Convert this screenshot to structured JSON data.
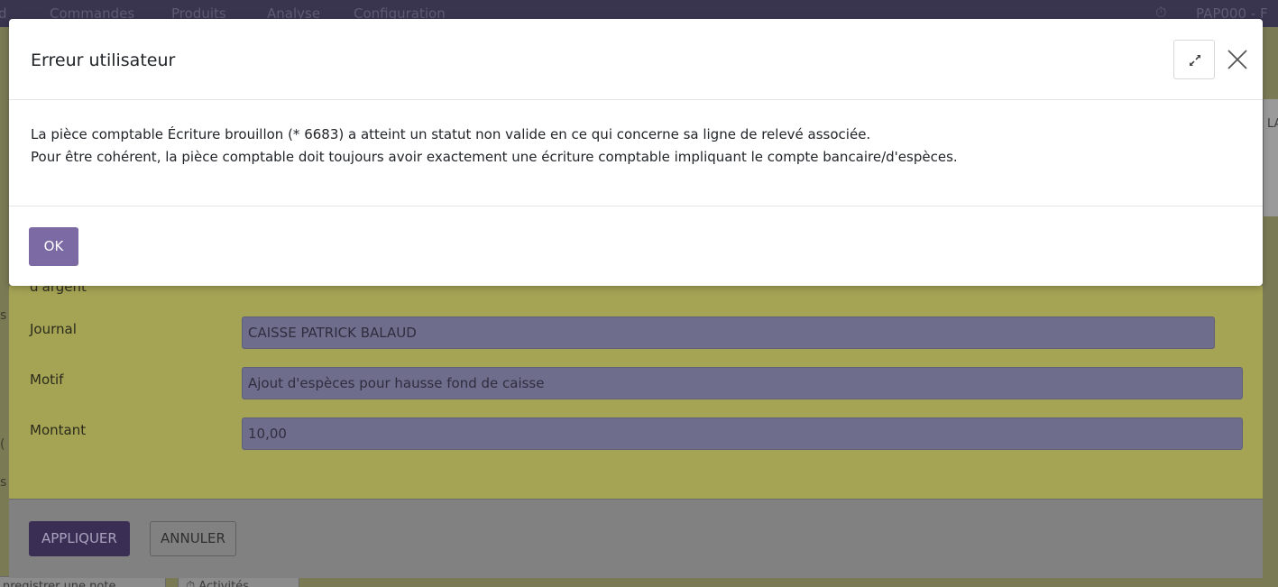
{
  "navbar": {
    "items": [
      "d",
      "Commandes",
      "Produits",
      "Analyse",
      "Configuration"
    ],
    "user": "PAP000 - F"
  },
  "background": {
    "left_fragments": [
      "s",
      "(",
      "s"
    ],
    "right_fragment": "LA",
    "bottom_buttons": [
      "nregistrer une note",
      "Activités"
    ]
  },
  "wizard": {
    "top_fragment": "d'argent",
    "fields": [
      {
        "label": "Journal",
        "value": "CAISSE PATRICK BALAUD"
      },
      {
        "label": "Motif",
        "value": "Ajout d'espèces pour hausse fond de caisse"
      },
      {
        "label": "Montant",
        "value": "10,00"
      }
    ],
    "apply_label": "APPLIQUER",
    "cancel_label": "ANNULER"
  },
  "modal": {
    "title": "Erreur utilisateur",
    "message_line1": "La pièce comptable Écriture brouillon (* 6683) a atteint un statut non valide en ce qui concerne sa ligne de relevé associée.",
    "message_line2": "Pour être cohérent, la pièce comptable doit toujours avoir exactement une écriture comptable impliquant le compte bancaire/d'espèces.",
    "ok_label": "OK"
  },
  "colors": {
    "primary": "#7c6aa5",
    "overlay_tint": "#a5a354"
  }
}
